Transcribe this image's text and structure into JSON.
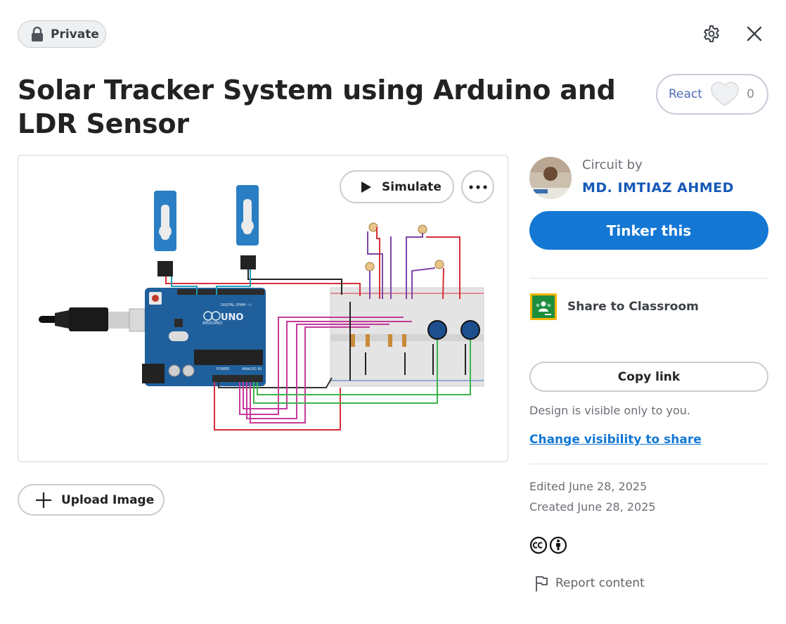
{
  "badge": {
    "label": "Private",
    "icon": "lock-icon"
  },
  "header": {
    "settings_icon": "gear-icon",
    "close_icon": "close-icon"
  },
  "title": "Solar Tracker System using Arduino and LDR Sensor",
  "react": {
    "label": "React",
    "count": "0",
    "icon": "heart-icon"
  },
  "preview": {
    "simulate_label": "Simulate",
    "more_icon": "more-horizontal-icon",
    "circuit_labels": {
      "board": "UNO",
      "brand": "ARDUINO",
      "digital": "DIGITAL (PWM ~)",
      "power": "POWER",
      "analog": "ANALOG IN"
    }
  },
  "upload": {
    "label": "Upload Image",
    "icon": "plus-icon"
  },
  "author": {
    "by_label": "Circuit by",
    "name": "MD. IMTIAZ AHMED"
  },
  "tinker": {
    "label": "Tinker this"
  },
  "classroom": {
    "label": "Share to Classroom",
    "icon": "google-classroom-icon"
  },
  "share": {
    "copy_label": "Copy link",
    "visibility_text": "Design is visible only to you.",
    "visibility_link": "Change visibility to share"
  },
  "dates": {
    "edited": "Edited June 28, 2025",
    "created": "Created June 28, 2025"
  },
  "license": {
    "icons": [
      "cc-icon",
      "attribution-icon"
    ]
  },
  "report": {
    "label": "Report content",
    "icon": "flag-icon"
  },
  "colors": {
    "accent": "#1477d4",
    "author": "#1559b6",
    "board": "#1f5f9c",
    "wire_red": "#d62f3a",
    "wire_magenta": "#c63a9b",
    "wire_green": "#3cb54a",
    "wire_purple": "#7d45a8"
  }
}
